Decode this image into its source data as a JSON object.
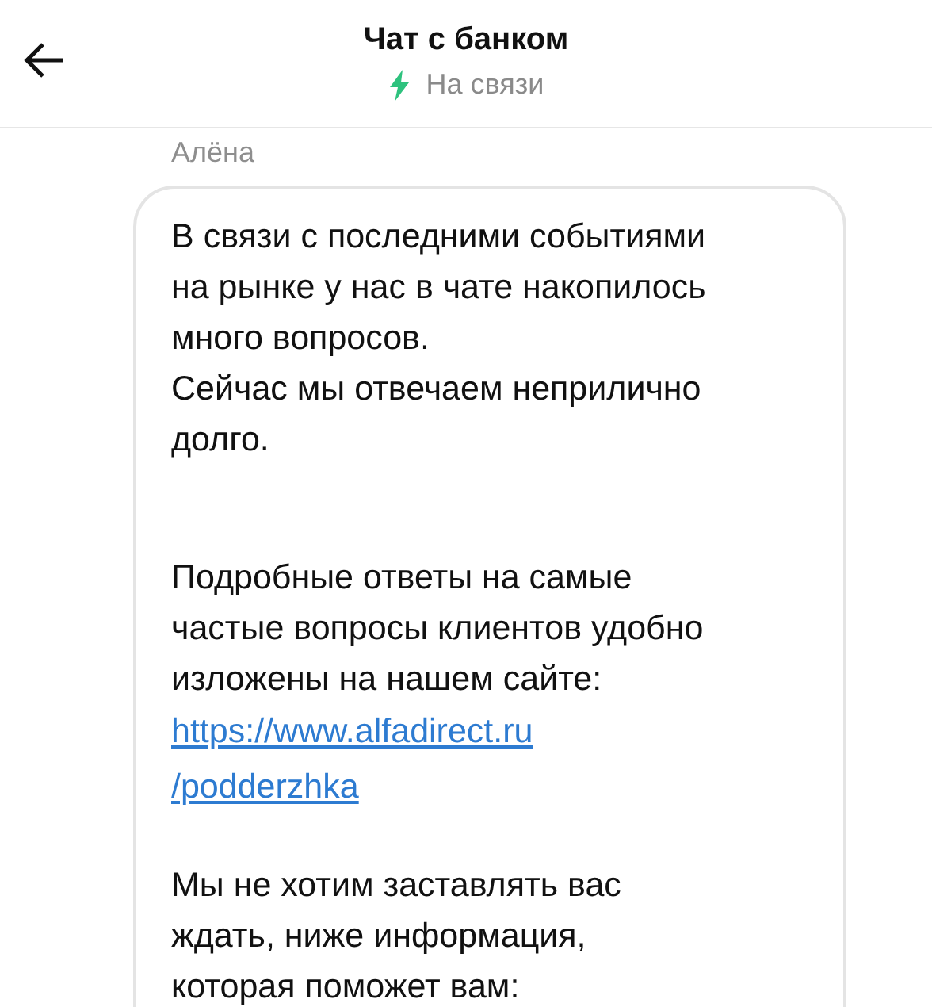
{
  "header": {
    "title": "Чат с банком",
    "status": "На связи"
  },
  "message": {
    "sender": "Алёна",
    "blocks": [
      {
        "kind": "text",
        "lines": [
          "В связи с последними событиями",
          "на рынке у нас в чате накопилось",
          "много вопросов.",
          "Сейчас мы отвечаем неприлично",
          "долго."
        ]
      },
      {
        "kind": "gap"
      },
      {
        "kind": "text",
        "lines": [
          "Подробные ответы на самые",
          "частые вопросы клиентов удобно",
          "изложены на нашем сайте:"
        ]
      },
      {
        "kind": "link",
        "lines": [
          "https://www.alfadirect.ru",
          "/podderzhka"
        ]
      },
      {
        "kind": "text",
        "lines": [
          "Мы не хотим заставлять вас",
          "ждать, ниже информация,",
          "которая поможет вам:"
        ]
      }
    ]
  }
}
